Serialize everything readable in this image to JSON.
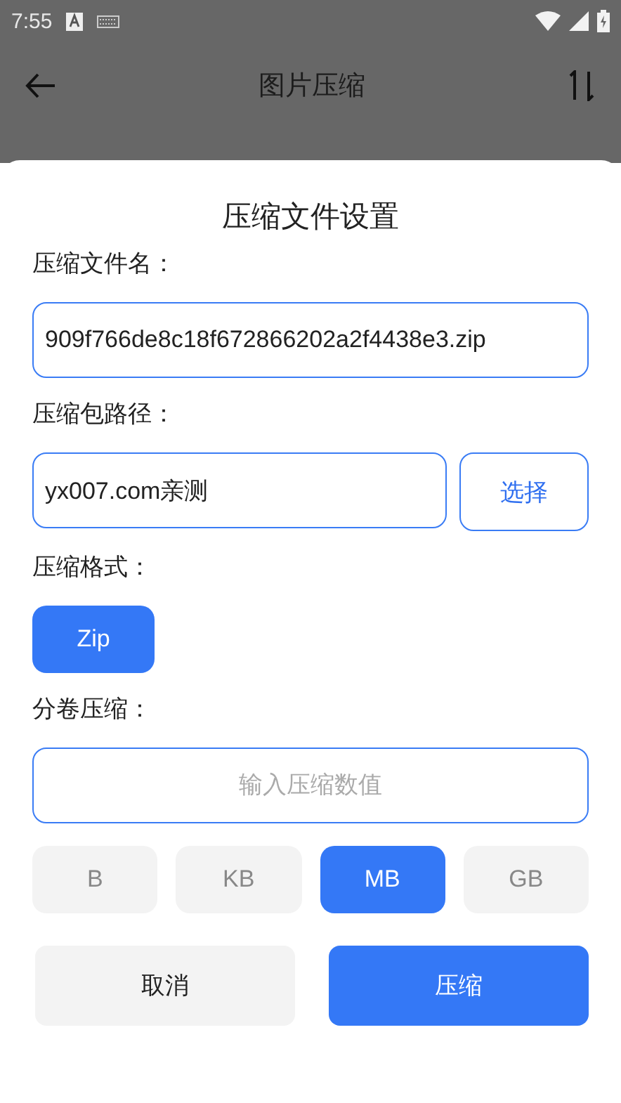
{
  "status_bar": {
    "time": "7:55"
  },
  "app_bar": {
    "title": "图片压缩"
  },
  "sheet": {
    "title": "压缩文件设置",
    "file_name": {
      "label": "压缩文件名：",
      "value": "909f766de8c18f672866202a2f4438e3.zip"
    },
    "path": {
      "label": "压缩包路径：",
      "value": "yx007.com亲测",
      "button": "选择"
    },
    "format": {
      "label": "压缩格式：",
      "options": [
        {
          "label": "Zip",
          "selected": true
        }
      ]
    },
    "split": {
      "label": "分卷压缩：",
      "placeholder": "输入压缩数值",
      "units": [
        {
          "label": "B",
          "selected": false
        },
        {
          "label": "KB",
          "selected": false
        },
        {
          "label": "MB",
          "selected": true
        },
        {
          "label": "GB",
          "selected": false
        }
      ]
    },
    "buttons": [
      {
        "label": "取消",
        "kind": "secondary"
      },
      {
        "label": "压缩",
        "kind": "primary"
      }
    ]
  }
}
